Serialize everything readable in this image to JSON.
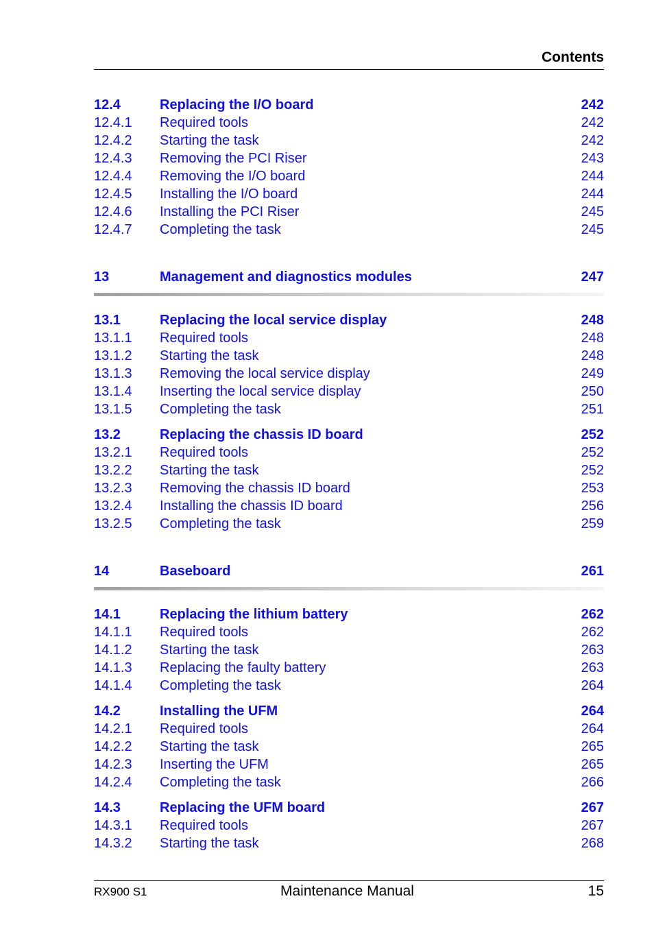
{
  "header": {
    "title": "Contents"
  },
  "toc": {
    "groups": [
      {
        "entries": [
          {
            "num": "12.4",
            "title": "Replacing the I/O board",
            "page": "242",
            "bold": true
          },
          {
            "num": "12.4.1",
            "title": "Required tools",
            "page": "242"
          },
          {
            "num": "12.4.2",
            "title": "Starting the task",
            "page": "242"
          },
          {
            "num": "12.4.3",
            "title": "Removing the PCI Riser",
            "page": "243"
          },
          {
            "num": "12.4.4",
            "title": "Removing the I/O board",
            "page": "244"
          },
          {
            "num": "12.4.5",
            "title": "Installing the I/O board",
            "page": "244"
          },
          {
            "num": "12.4.6",
            "title": "Installing the PCI Riser",
            "page": "245"
          },
          {
            "num": "12.4.7",
            "title": "Completing the task",
            "page": "245"
          }
        ]
      },
      {
        "chapter": {
          "num": "13",
          "title": "Management and diagnostics modules",
          "page": "247"
        }
      },
      {
        "entries": [
          {
            "num": "13.1",
            "title": "Replacing the local service display",
            "page": "248",
            "bold": true
          },
          {
            "num": "13.1.1",
            "title": "Required tools",
            "page": "248"
          },
          {
            "num": "13.1.2",
            "title": "Starting the task",
            "page": "248"
          },
          {
            "num": "13.1.3",
            "title": "Removing the local service display",
            "page": "249"
          },
          {
            "num": "13.1.4",
            "title": "Inserting the local service display",
            "page": "250"
          },
          {
            "num": "13.1.5",
            "title": "Completing the task",
            "page": "251"
          }
        ]
      },
      {
        "entries": [
          {
            "num": "13.2",
            "title": "Replacing the chassis ID board",
            "page": "252",
            "bold": true
          },
          {
            "num": "13.2.1",
            "title": "Required tools",
            "page": "252"
          },
          {
            "num": "13.2.2",
            "title": "Starting the task",
            "page": "252"
          },
          {
            "num": "13.2.3",
            "title": "Removing the chassis ID board",
            "page": "253"
          },
          {
            "num": "13.2.4",
            "title": "Installing the chassis ID board",
            "page": "256"
          },
          {
            "num": "13.2.5",
            "title": "Completing the task",
            "page": "259"
          }
        ]
      },
      {
        "chapter": {
          "num": "14",
          "title": "Baseboard",
          "page": "261"
        }
      },
      {
        "entries": [
          {
            "num": "14.1",
            "title": "Replacing the lithium battery",
            "page": "262",
            "bold": true
          },
          {
            "num": "14.1.1",
            "title": "Required tools",
            "page": "262"
          },
          {
            "num": "14.1.2",
            "title": "Starting the task",
            "page": "263"
          },
          {
            "num": "14.1.3",
            "title": "Replacing the faulty battery",
            "page": "263"
          },
          {
            "num": "14.1.4",
            "title": "Completing the task",
            "page": "264"
          }
        ]
      },
      {
        "entries": [
          {
            "num": "14.2",
            "title": "Installing the UFM",
            "page": "264",
            "bold": true
          },
          {
            "num": "14.2.1",
            "title": "Required tools",
            "page": "264"
          },
          {
            "num": "14.2.2",
            "title": "Starting the task",
            "page": "265"
          },
          {
            "num": "14.2.3",
            "title": "Inserting the UFM",
            "page": "265"
          },
          {
            "num": "14.2.4",
            "title": "Completing the task",
            "page": "266"
          }
        ]
      },
      {
        "entries": [
          {
            "num": "14.3",
            "title": "Replacing the UFM board",
            "page": "267",
            "bold": true
          },
          {
            "num": "14.3.1",
            "title": "Required tools",
            "page": "267"
          },
          {
            "num": "14.3.2",
            "title": "Starting the task",
            "page": "268"
          }
        ]
      }
    ]
  },
  "footer": {
    "left": "RX900 S1",
    "center": "Maintenance Manual",
    "page_number": "15"
  }
}
